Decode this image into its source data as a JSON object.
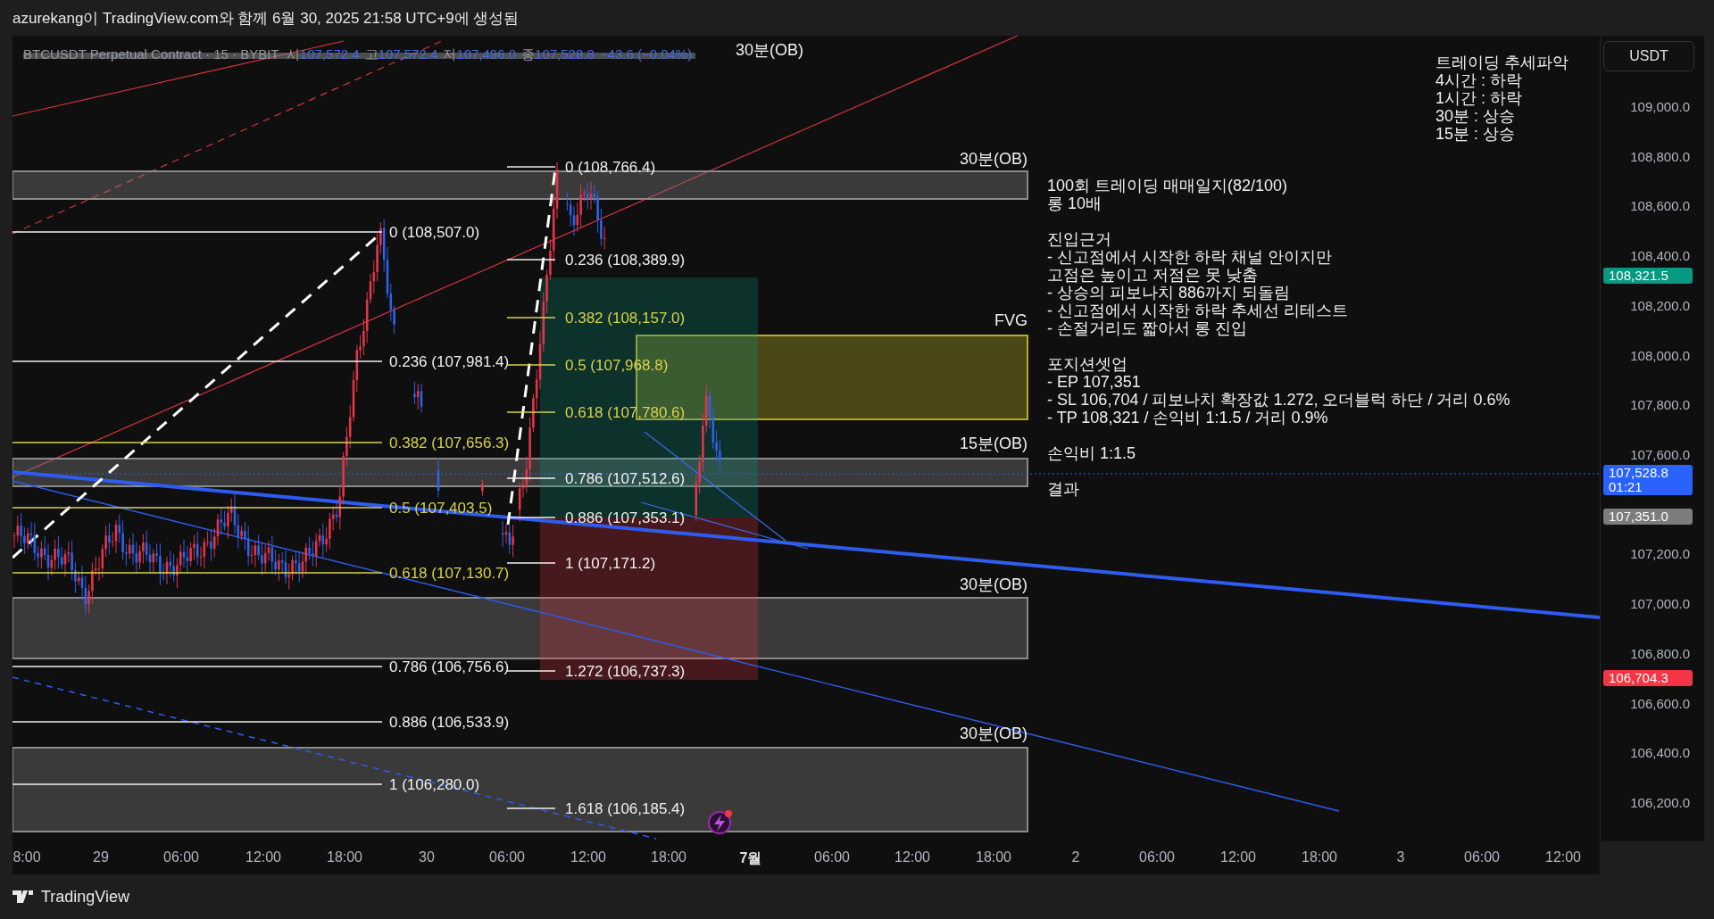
{
  "header": {
    "caption": "azurekang이 TradingView.com와 함께 6월 30, 2025 21:58 UTC+9에 생성됨"
  },
  "legend": {
    "symbol": "BTCUSDT Perpetual Contract · 15 · BYBIT",
    "fields": [
      {
        "label": "시",
        "value": "107,572.4"
      },
      {
        "label": "고",
        "value": "107,572.4"
      },
      {
        "label": "저",
        "value": "107,496.0"
      },
      {
        "label": "종",
        "value": "107,528.8"
      }
    ],
    "change": "−43.6 (−0.04%)"
  },
  "top_zone_label": "30분(OB)",
  "zones": [
    {
      "label": "30분(OB)",
      "kind": "ob"
    },
    {
      "label": "FVG",
      "kind": "fvg"
    },
    {
      "label": "15분(OB)",
      "kind": "ob"
    },
    {
      "label": "30분(OB)",
      "kind": "ob"
    },
    {
      "label": "30분(OB)",
      "kind": "ob"
    }
  ],
  "fib_left": [
    {
      "label": "0 (108,507.0)",
      "kind": "white"
    },
    {
      "label": "0.236 (107,981.4)",
      "kind": "white"
    },
    {
      "label": "0.382 (107,656.3)",
      "kind": "yellow"
    },
    {
      "label": "0.5 (107,403.5)",
      "kind": "yellow"
    },
    {
      "label": "0.618 (107,130.7)",
      "kind": "yellow"
    },
    {
      "label": "0.786 (106,756.6)",
      "kind": "white"
    },
    {
      "label": "0.886 (106,533.9)",
      "kind": "white"
    },
    {
      "label": "1 (106,280.0)",
      "kind": "white"
    }
  ],
  "fib_right": [
    {
      "label": "0 (108,766.4)",
      "kind": "white"
    },
    {
      "label": "0.236 (108,389.9)",
      "kind": "white"
    },
    {
      "label": "0.382 (108,157.0)",
      "kind": "yellow"
    },
    {
      "label": "0.5 (107,968.8)",
      "kind": "yellow"
    },
    {
      "label": "0.618 (107,780.6)",
      "kind": "yellow"
    },
    {
      "label": "0.786 (107,512.6)",
      "kind": "white"
    },
    {
      "label": "0.886 (107,353.1)",
      "kind": "white"
    },
    {
      "label": "1 (107,171.2)",
      "kind": "white"
    },
    {
      "label": "1.272 (106,737.3)",
      "kind": "white"
    },
    {
      "label": "1.618 (106,185.4)",
      "kind": "white"
    }
  ],
  "trend_note": [
    "트레이딩 추세파악",
    "4시간 : 하락",
    "1시간 : 하락",
    "30분 : 상승",
    "15분 : 상승"
  ],
  "journal": [
    [
      "100회 트레이딩 매매일지(82/100)",
      "롱 10배"
    ],
    [
      "진입근거",
      "- 신고점에서 시작한 하락 채널 안이지만",
      "고점은 높이고 저점은 못 낮춤",
      "- 상승의 피보나치 886까지 되돌림",
      "- 신고점에서 시작한 하락 추세선 리테스트",
      "- 손절거리도 짧아서 롱 진입"
    ],
    [
      "포지션셋업",
      "- EP 107,351",
      "- SL 106,704 / 피보나치 확장값 1.272, 오더블럭 하단 / 거리 0.6%",
      "- TP 108,321 / 손익비 1:1.5 / 거리 0.9%"
    ],
    [
      "손익비 1:1.5"
    ],
    [
      "결과"
    ]
  ],
  "price_axis": {
    "currency": "USDT",
    "ticks": [
      "109,000.0",
      "108,800.0",
      "108,600.0",
      "108,400.0",
      "108,200.0",
      "108,000.0",
      "107,800.0",
      "107,600.0",
      "107,200.0",
      "107,000.0",
      "106,800.0",
      "106,600.0",
      "106,400.0",
      "106,200.0"
    ],
    "markers": [
      {
        "price": "108,321.5",
        "kind": "tp"
      },
      {
        "price": "107,528.8",
        "kind": "last",
        "countdown": "01:21"
      },
      {
        "price": "107,351.0",
        "kind": "entry"
      },
      {
        "price": "106,704.3",
        "kind": "sl"
      }
    ]
  },
  "time_axis": [
    {
      "label": "8:00",
      "bold": false
    },
    {
      "label": "29",
      "bold": false
    },
    {
      "label": "06:00",
      "bold": false
    },
    {
      "label": "12:00",
      "bold": false
    },
    {
      "label": "18:00",
      "bold": false
    },
    {
      "label": "30",
      "bold": false
    },
    {
      "label": "06:00",
      "bold": false
    },
    {
      "label": "12:00",
      "bold": false
    },
    {
      "label": "18:00",
      "bold": false
    },
    {
      "label": "7월",
      "bold": true
    },
    {
      "label": "06:00",
      "bold": false
    },
    {
      "label": "12:00",
      "bold": false
    },
    {
      "label": "18:00",
      "bold": false
    },
    {
      "label": "2",
      "bold": false
    },
    {
      "label": "06:00",
      "bold": false
    },
    {
      "label": "12:00",
      "bold": false
    },
    {
      "label": "18:00",
      "bold": false
    },
    {
      "label": "3",
      "bold": false
    },
    {
      "label": "06:00",
      "bold": false
    },
    {
      "label": "12:00",
      "bold": false
    }
  ],
  "footer": {
    "brand": "TradingView"
  }
}
